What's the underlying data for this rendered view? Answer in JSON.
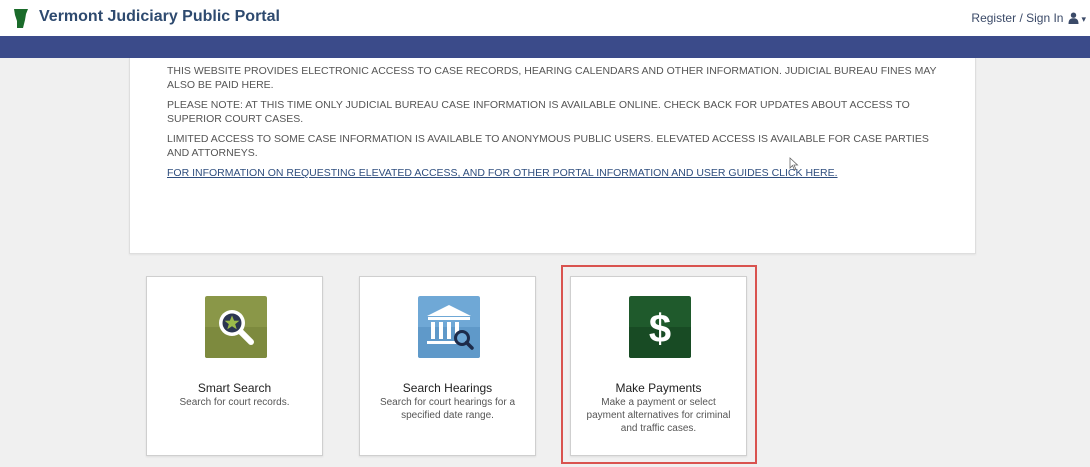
{
  "header": {
    "title": "Vermont Judiciary Public Portal",
    "signin_label": "Register / Sign In",
    "user_icon": "user-icon",
    "caret_icon": "chevron-down-icon"
  },
  "colors": {
    "nav_bar": "#3b4b8a",
    "title_text": "#2e4a6f",
    "logo_green": "#1a6b2a",
    "smart_search_tile": "#8a9748",
    "hearings_tile": "#6fa8d6",
    "payments_tile": "#1f5a2c",
    "highlight_border": "#d9534f"
  },
  "info": {
    "paragraphs": [
      "THIS WEBSITE PROVIDES ELECTRONIC ACCESS TO CASE RECORDS, HEARING CALENDARS AND OTHER INFORMATION. JUDICIAL BUREAU FINES MAY ALSO BE PAID HERE.",
      "PLEASE NOTE: AT THIS TIME ONLY JUDICIAL BUREAU CASE INFORMATION IS AVAILABLE ONLINE. CHECK BACK FOR UPDATES ABOUT ACCESS TO SUPERIOR COURT CASES.",
      "LIMITED ACCESS TO SOME CASE INFORMATION IS AVAILABLE TO ANONYMOUS PUBLIC USERS. ELEVATED ACCESS IS AVAILABLE FOR CASE PARTIES AND ATTORNEYS."
    ],
    "link": "FOR INFORMATION ON REQUESTING ELEVATED ACCESS, AND FOR OTHER PORTAL INFORMATION AND USER GUIDES CLICK HERE."
  },
  "tiles": [
    {
      "name": "Smart Search",
      "description": "Search for court records.",
      "icon": "magnifier-star-icon"
    },
    {
      "name": "Search Hearings",
      "description": "Search for court hearings for a specified date range.",
      "icon": "courthouse-search-icon"
    },
    {
      "name": "Make Payments",
      "description": "Make a payment or select payment alternatives for criminal and traffic cases.",
      "icon": "dollar-icon"
    }
  ]
}
